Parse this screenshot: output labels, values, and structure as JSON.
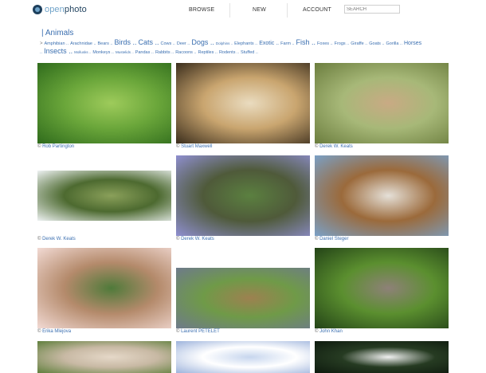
{
  "header": {
    "logo_open": "open",
    "logo_photo": "photo",
    "nav": [
      "BROWSE",
      "NEW",
      "ACCOUNT"
    ],
    "search_placeholder": "SEARCH"
  },
  "category": {
    "title": "| Animals",
    "tags_line1": [
      {
        "t": "Amphibian ..",
        "s": "sm2"
      },
      {
        "t": "Arachnidae ..",
        "s": "sm2"
      },
      {
        "t": "Bears ..",
        "s": "sm2"
      },
      {
        "t": "Birds ..",
        "s": "lg"
      },
      {
        "t": "Cats ..",
        "s": "lg"
      },
      {
        "t": "Cows ..",
        "s": "sm2"
      },
      {
        "t": "Deer ..",
        "s": "sm2"
      },
      {
        "t": "Dogs ..",
        "s": "lg"
      },
      {
        "t": "Dolphins ..",
        "s": "sm"
      },
      {
        "t": "Elephants ..",
        "s": "sm2"
      },
      {
        "t": "Exotic ..",
        "s": "md"
      },
      {
        "t": "Farm ..",
        "s": "sm2"
      },
      {
        "t": "Fish ..",
        "s": "lg"
      },
      {
        "t": "Foxes ..",
        "s": "sm2"
      },
      {
        "t": "Frogs ..",
        "s": "sm2"
      },
      {
        "t": "Giraffe ..",
        "s": "sm2"
      },
      {
        "t": "Goats ..",
        "s": "sm2"
      },
      {
        "t": "Gorilla ..",
        "s": "sm2"
      },
      {
        "t": "Horses",
        "s": "md"
      }
    ],
    "tags_line2": [
      {
        "t": "..",
        "s": "sm2"
      },
      {
        "t": "Insects ..",
        "s": "lg"
      },
      {
        "t": "Mollusks ..",
        "s": "sm"
      },
      {
        "t": "Monkeys ..",
        "s": "sm2"
      },
      {
        "t": "Mustelids ..",
        "s": "sm"
      },
      {
        "t": "Pandas ..",
        "s": "sm2"
      },
      {
        "t": "Rabbits ..",
        "s": "sm2"
      },
      {
        "t": "Racoons ..",
        "s": "sm2"
      },
      {
        "t": "Reptiles ..",
        "s": "sm2"
      },
      {
        "t": "Rodents ..",
        "s": "sm2"
      },
      {
        "t": "Stuffed ..",
        "s": "sm2"
      }
    ]
  },
  "photos": [
    {
      "name": "duck-on-grass",
      "credit": "Rob Partington",
      "colors": [
        "#2f6b1c",
        "#6aa63a",
        "#9ecb5b"
      ]
    },
    {
      "name": "cheetah-face",
      "credit": "Stuart Maxwell",
      "colors": [
        "#3a2d1c",
        "#c9a56f",
        "#eadcc0"
      ]
    },
    {
      "name": "jackal-in-grass",
      "credit": "Derek W. Keats",
      "colors": [
        "#6b7d3e",
        "#a7b878",
        "#c9aa84"
      ]
    },
    {
      "name": "zebras-herd",
      "credit": "Derek W. Keats",
      "colors": [
        "#eef2f3",
        "#4d6a30",
        "#8aa05a"
      ]
    },
    {
      "name": "elephant-savanna",
      "credit": "Derek W. Keats",
      "colors": [
        "#8f8fd0",
        "#4f5a3a",
        "#5b8040"
      ]
    },
    {
      "name": "dog-face",
      "credit": "Daniel Steger",
      "colors": [
        "#7aa0c6",
        "#9b6a3b",
        "#e5e0d8"
      ]
    },
    {
      "name": "hand-with-beads",
      "credit": "Erika Mlejova",
      "colors": [
        "#f2dad4",
        "#b48a6b",
        "#4f7a3a"
      ]
    },
    {
      "name": "deer-herd-field",
      "credit": "Laurent PETELET",
      "colors": [
        "#6e7a8b",
        "#6f9a48",
        "#9d8150"
      ]
    },
    {
      "name": "puppy-on-grass",
      "credit": "John Khan",
      "colors": [
        "#234317",
        "#5b8f2f",
        "#8e8178"
      ]
    },
    {
      "name": "partial-photo-1",
      "credit": "",
      "colors": [
        "#5f7f3c",
        "#c8b9a4",
        "#e5d8c8"
      ]
    },
    {
      "name": "partial-photo-2",
      "credit": "",
      "colors": [
        "#9db3dc",
        "#ffffff",
        "#c7d6ee"
      ]
    },
    {
      "name": "partial-photo-3",
      "credit": "",
      "colors": [
        "#0e1a0e",
        "#263b22",
        "#f0f0f0"
      ]
    }
  ]
}
